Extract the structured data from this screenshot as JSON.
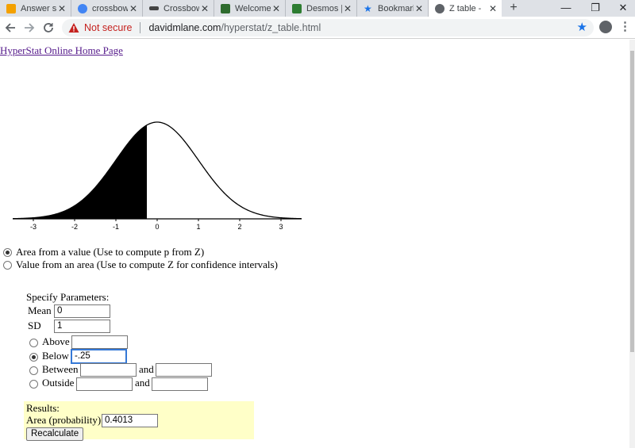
{
  "browser": {
    "tabs": [
      {
        "title": "Answer st",
        "favicon_color": "#f4a100",
        "active": false
      },
      {
        "title": "crossbow",
        "favicon_color": "#4285f4",
        "active": false
      },
      {
        "title": "Crossbow",
        "favicon_color": "#444444",
        "active": false
      },
      {
        "title": "Welcome",
        "favicon_color": "#2e6b2e",
        "active": false
      },
      {
        "title": "Desmos |",
        "favicon_color": "#2e7d32",
        "active": false
      },
      {
        "title": "Bookmark",
        "favicon_color": "#1a73e8",
        "active": false
      },
      {
        "title": "Z table -",
        "favicon_color": "#5f6368",
        "active": true
      }
    ],
    "close_glyph": "✕",
    "new_tab_glyph": "+",
    "window_controls": {
      "minimize": "—",
      "restore": "❐",
      "close": "✕"
    },
    "security_label": "Not secure",
    "url_host": "davidmlane.com",
    "url_path": "/hyperstat/z_table.html"
  },
  "page": {
    "home_link": "HyperStat Online Home Page",
    "modes": [
      {
        "label": "Area from a value (Use to compute p from Z)",
        "selected": true
      },
      {
        "label": "Value from an area (Use to compute Z for confidence intervals)",
        "selected": false
      }
    ],
    "params": {
      "heading": "Specify Parameters:",
      "mean_label": "Mean",
      "mean_value": "0",
      "sd_label": "SD",
      "sd_value": "1",
      "above_label": "Above",
      "above_value": "",
      "below_label": "Below",
      "below_value": "-.25",
      "between_label": "Between",
      "between_and": "and",
      "between_low": "",
      "between_high": "",
      "outside_label": "Outside",
      "outside_and": "and",
      "outside_low": "",
      "outside_high": "",
      "selected_option": "Below"
    },
    "results": {
      "heading": "Results:",
      "area_label": "Area (probability)",
      "area_value": "0.4013",
      "recalculate_label": "Recalculate"
    }
  },
  "chart_data": {
    "type": "area",
    "description_type": "normal-density",
    "mean": 0,
    "sd": 1,
    "shaded_region": {
      "from": -3.5,
      "to": -0.25
    },
    "x_ticks": [
      -3,
      -2,
      -1,
      0,
      1,
      2,
      3
    ],
    "x_tick_labels": [
      "-3",
      "-2",
      "-1",
      "0",
      "1",
      "2",
      "3"
    ],
    "xlim": [
      -3.5,
      3.5
    ],
    "colors": {
      "fill": "#000000",
      "curve": "#000000"
    }
  }
}
